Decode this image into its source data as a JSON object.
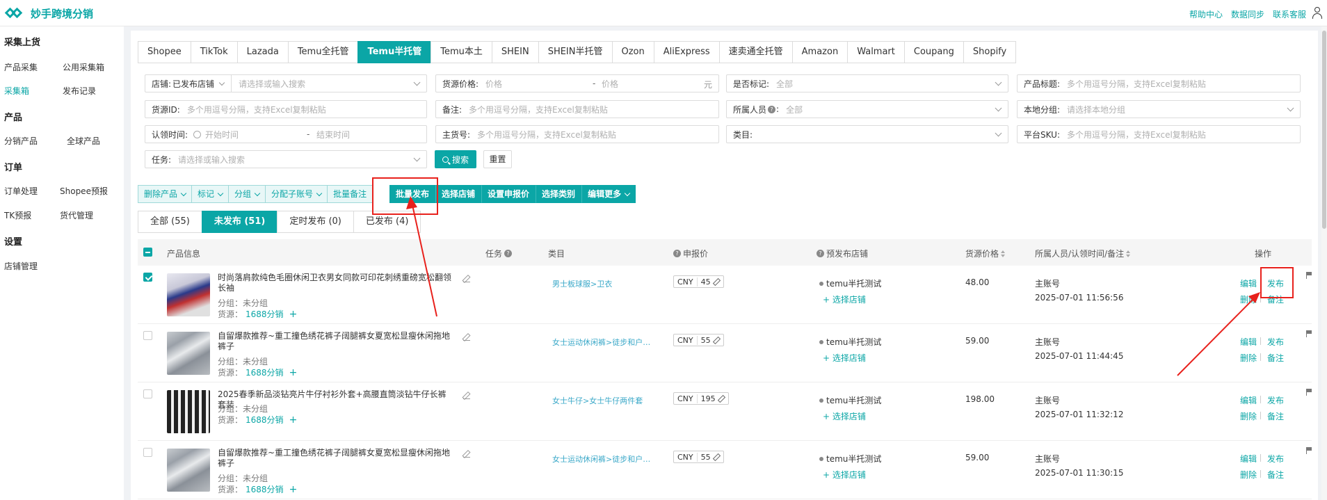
{
  "header": {
    "brand": "妙手跨境分销",
    "links": [
      "帮助中心",
      "数据同步",
      "联系客服"
    ]
  },
  "sidebar": {
    "groups": [
      {
        "title": "采集上货",
        "items": [
          "产品采集",
          "公用采集箱",
          "采集箱",
          "发布记录"
        ]
      },
      {
        "title": "产品",
        "items": [
          "分销产品",
          "全球产品"
        ]
      },
      {
        "title": "订单",
        "items": [
          "订单处理",
          "Shopee预报",
          "TK预报",
          "货代管理"
        ]
      },
      {
        "title": "设置",
        "items": [
          "店铺管理"
        ]
      }
    ],
    "active": "采集箱"
  },
  "platform_tabs": [
    "Shopee",
    "TikTok",
    "Lazada",
    "Temu全托管",
    "Temu半托管",
    "Temu本土",
    "SHEIN",
    "SHEIN半托管",
    "Ozon",
    "AliExpress",
    "速卖通全托管",
    "Amazon",
    "Walmart",
    "Coupang",
    "Shopify"
  ],
  "platform_active": "Temu半托管",
  "filters": {
    "shop": {
      "label": "店铺:",
      "value": "已发布店铺",
      "placeholder": "请选择或输入搜索"
    },
    "source_price": {
      "label": "货源价格:",
      "ph_min": "价格",
      "ph_max": "价格",
      "dash": "-",
      "unit": "元"
    },
    "marked": {
      "label": "是否标记:",
      "value": "全部"
    },
    "title": {
      "label": "产品标题:",
      "placeholder": "多个用逗号分隔，支持Excel复制粘贴"
    },
    "source_id": {
      "label": "货源ID:",
      "placeholder": "多个用逗号分隔，支持Excel复制粘贴"
    },
    "remark": {
      "label": "备注:",
      "placeholder": "多个用逗号分隔，支持Excel复制粘贴"
    },
    "owner": {
      "label": "所属人员",
      "value": "全部"
    },
    "local_group": {
      "label": "本地分组:",
      "placeholder": "请选择本地分组"
    },
    "claim_time": {
      "label": "认领时间:",
      "ph_start": "开始时间",
      "dash": "-",
      "ph_end": "结束时间"
    },
    "main_sku": {
      "label": "主货号:",
      "placeholder": "多个用逗号分隔，支持Excel复制粘贴"
    },
    "category": {
      "label": "类目:"
    },
    "platform_sku": {
      "label": "平台SKU:",
      "placeholder": "多个用逗号分隔，支持Excel复制粘贴"
    },
    "task": {
      "label": "任务:",
      "placeholder": "请选择或输入搜索"
    },
    "search_label": "搜索",
    "reset_label": "重置"
  },
  "actions": {
    "left": [
      "删除产品",
      "标记",
      "分组",
      "分配子账号",
      "批量备注"
    ],
    "right": [
      "批量发布",
      "选择店铺",
      "设置申报价",
      "选择类别",
      "编辑更多"
    ]
  },
  "status_tabs": [
    "全部 (55)",
    "未发布 (51)",
    "定时发布 (0)",
    "已发布 (4)"
  ],
  "status_active": "未发布 (51)",
  "table": {
    "headers": {
      "product": "产品信息",
      "task": "任务",
      "category": "类目",
      "declared": "申报价",
      "store": "预发布店铺",
      "source_price": "货源价格",
      "owner": "所属人员/认领时间/备注",
      "ops": "操作"
    },
    "group_prefix": "分组：",
    "source_prefix": "货源：",
    "add_store": "+ 选择店铺",
    "op_labels": {
      "edit": "编辑",
      "publish": "发布",
      "delete": "删除",
      "remark": "备注"
    },
    "rows": [
      {
        "title": "时尚落肩款纯色毛圈休闲卫衣男女同款可印花刺绣重磅宽松翻领长袖",
        "group": "未分组",
        "source": "1688分销",
        "category": "男士板球服>卫衣",
        "currency": "CNY",
        "declared": "45",
        "store": "temu半托测试",
        "source_price": "48.00",
        "owner": "主账号",
        "time": "2025-07-01 11:56:56",
        "checked": true
      },
      {
        "title": "自留爆款推荐~重工撞色绣花裤子阔腿裤女夏宽松显瘦休闲拖地裤子",
        "group": "未分组",
        "source": "1688分销",
        "category": "女士运动休闲裤>徒步和户…",
        "currency": "CNY",
        "declared": "55",
        "store": "temu半托测试",
        "source_price": "59.00",
        "owner": "主账号",
        "time": "2025-07-01 11:44:45",
        "checked": false
      },
      {
        "title": "2025春季新品淡钻亮片牛仔衬衫外套+高腰直筒淡钻牛仔长裤套装",
        "group": "未分组",
        "source": "1688分销",
        "category": "女士牛仔>女士牛仔两件套",
        "currency": "CNY",
        "declared": "195",
        "store": "temu半托测试",
        "source_price": "198.00",
        "owner": "主账号",
        "time": "2025-07-01 11:32:12",
        "checked": false
      },
      {
        "title": "自留爆款推荐~重工撞色绣花裤子阔腿裤女夏宽松显瘦休闲拖地裤子",
        "group": "未分组",
        "source": "1688分销",
        "category": "女士运动休闲裤>徒步和户…",
        "currency": "CNY",
        "declared": "55",
        "store": "temu半托测试",
        "source_price": "59.00",
        "owner": "主账号",
        "time": "2025-07-01 11:30:15",
        "checked": false
      }
    ]
  },
  "colors": {
    "accent": "#0ba6a6",
    "highlight": "#e8211c"
  }
}
